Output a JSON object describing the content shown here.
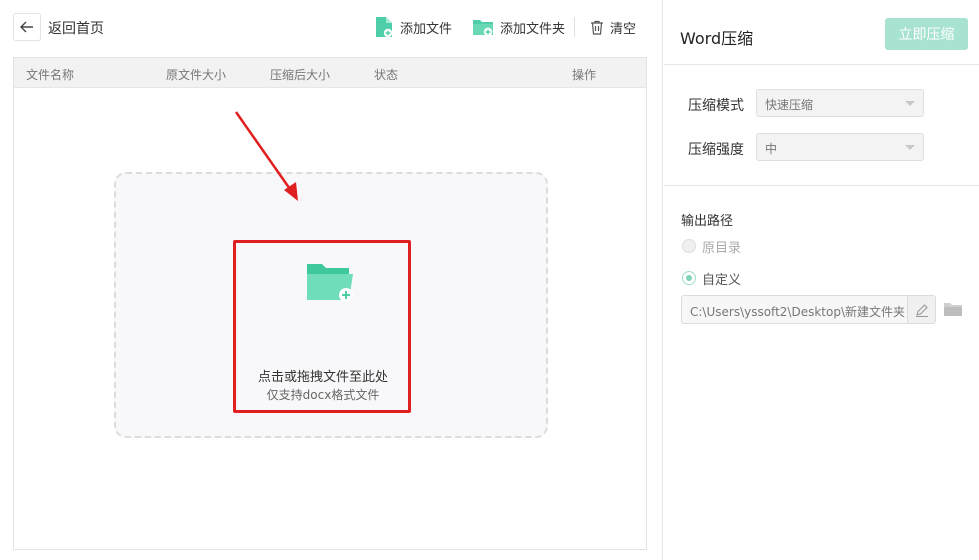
{
  "topbar": {
    "back_label": "返回首页",
    "add_file": "添加文件",
    "add_folder": "添加文件夹",
    "clear": "清空"
  },
  "table": {
    "columns": [
      "文件名称",
      "原文件大小",
      "压缩后大小",
      "状态",
      "操作"
    ]
  },
  "dropzone": {
    "title": "点击或拖拽文件至此处",
    "subtitle": "仅支持docx格式文件"
  },
  "panel": {
    "title": "Word压缩",
    "compress_button": "立即压缩",
    "mode_label": "压缩模式",
    "mode_value": "快速压缩",
    "strength_label": "压缩强度",
    "strength_value": "中",
    "output_label": "输出路径",
    "option_original": "原目录",
    "option_custom": "自定义",
    "selected_option": "自定义",
    "output_path": "C:\\Users\\yssoft2\\Desktop\\新建文件夹"
  },
  "colors": {
    "accent": "#4fcfa9",
    "accent_disabled": "#a8e2d0",
    "highlight_red": "#e02020"
  },
  "icons": {
    "back": "arrow-left-icon",
    "add_file": "file-add-icon",
    "add_folder": "folder-add-icon",
    "clear": "trash-icon",
    "drop": "folder-plus-icon",
    "edit_path": "pen-icon",
    "browse": "folder-icon"
  }
}
